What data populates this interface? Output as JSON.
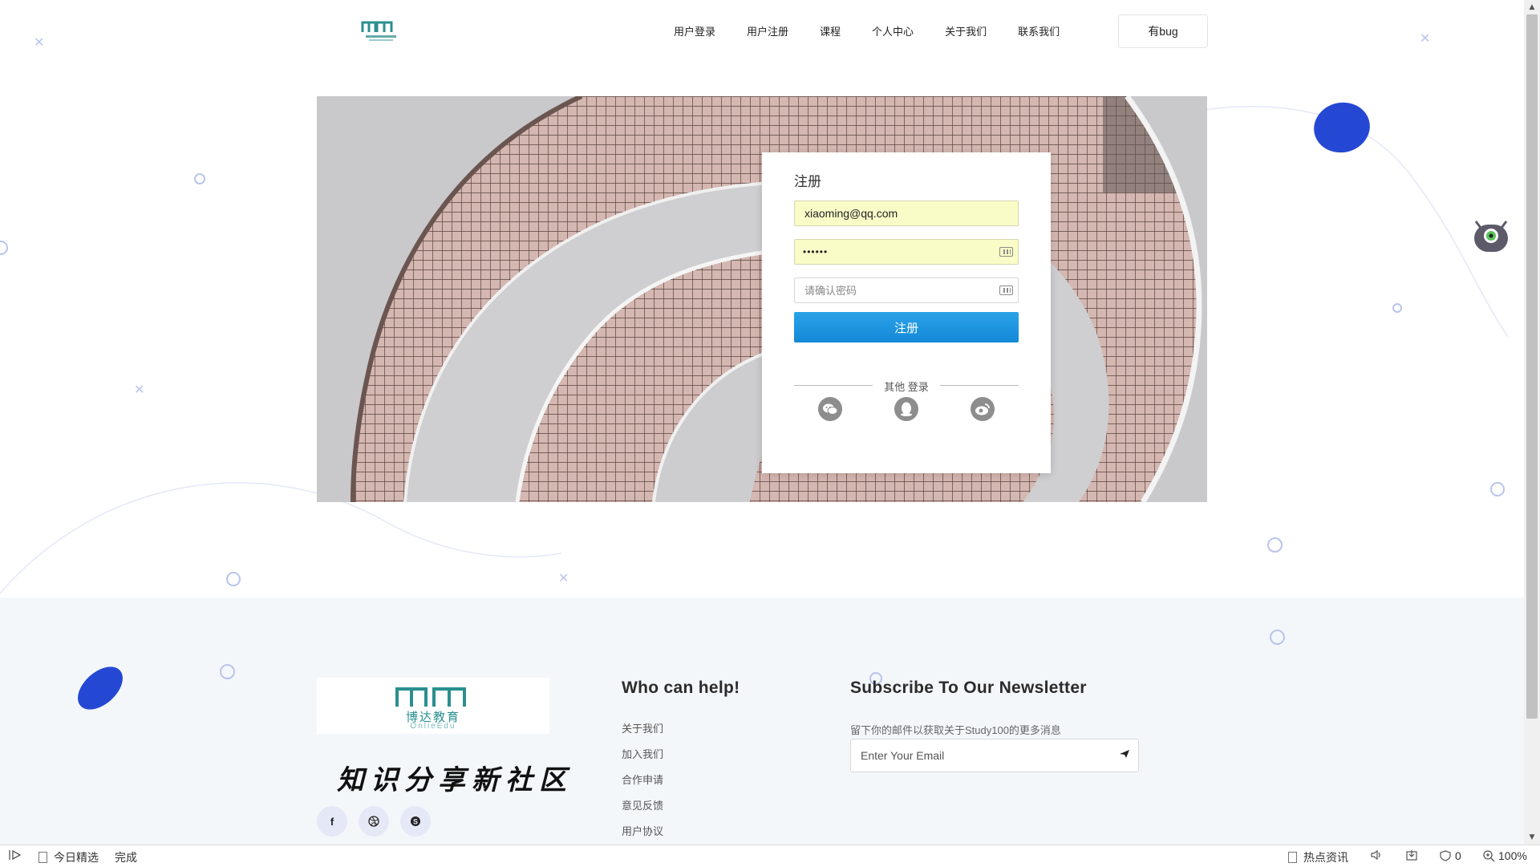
{
  "header": {
    "logo_text": "博达教育",
    "nav": [
      "用户登录",
      "用户注册",
      "课程",
      "个人中心",
      "关于我们",
      "联系我们"
    ],
    "button": "有bug"
  },
  "register": {
    "title": "注册",
    "email_value": "xiaoming@qq.com",
    "password_value": "••••••",
    "confirm_placeholder": "请确认密码",
    "submit_label": "注册",
    "other_label": "其他 登录",
    "social": [
      "wechat-icon",
      "qq-icon",
      "weibo-icon"
    ]
  },
  "footer": {
    "logo_cn": "博达教育",
    "logo_en": "OnlieEdu",
    "slogan": "知识分享新社区",
    "social": [
      "f",
      "dribbble-icon",
      "skype-icon"
    ],
    "help_title": "Who can help!",
    "help_links": [
      "关于我们",
      "加入我们",
      "合作申请",
      "意见反馈",
      "用户协议"
    ],
    "newsletter_title": "Subscribe To Our Newsletter",
    "newsletter_desc": "留下你的邮件以获取关于Study100的更多消息",
    "email_placeholder": "Enter Your Email"
  },
  "statusbar": {
    "left_text": "今日精选",
    "status": "完成",
    "hot": "热点资讯",
    "count": "0",
    "zoom": "100%"
  },
  "colors": {
    "accent_blue": "#1e90dc",
    "blob_blue": "#2548d4",
    "decor": "#b9c4ec"
  }
}
